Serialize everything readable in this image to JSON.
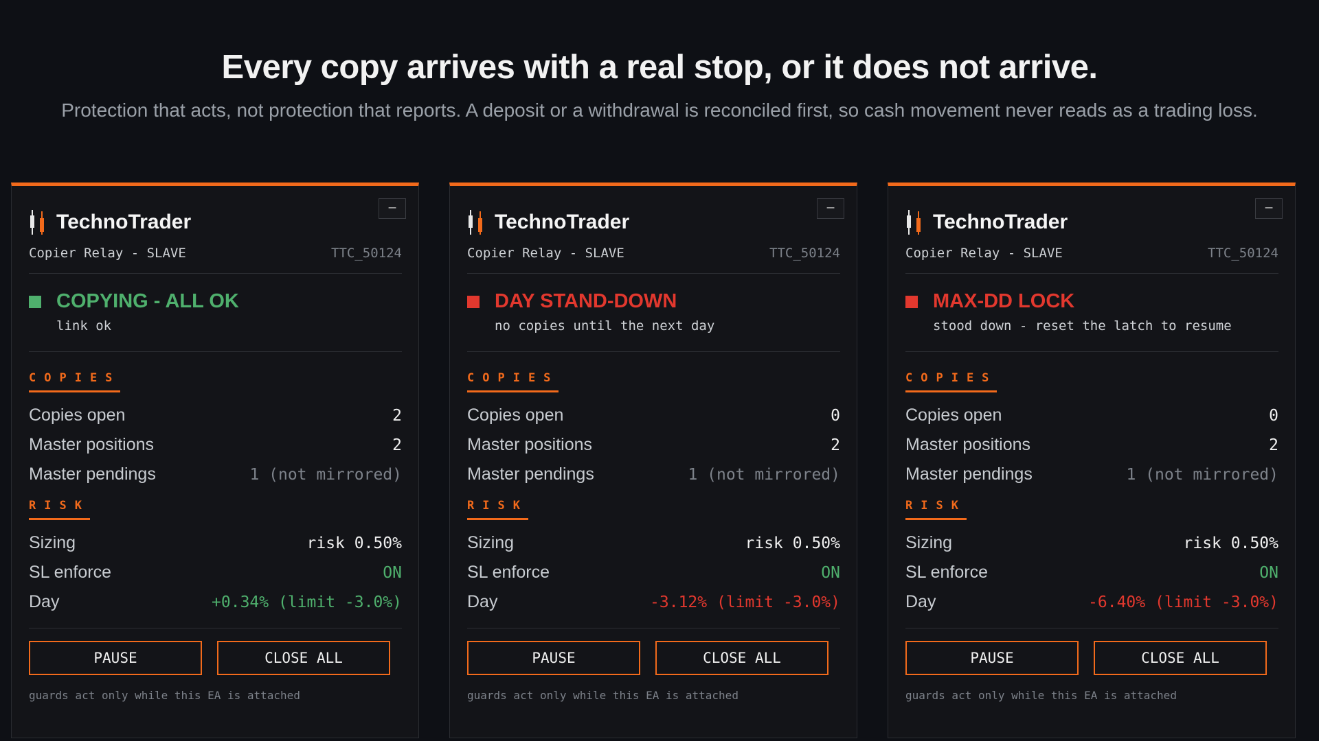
{
  "hero": {
    "title": "Every copy arrives with a real stop, or it does not arrive.",
    "subtitle": "Protection that acts, not protection that reports. A deposit or a withdrawal is reconciled first, so cash movement never reads as a trading loss."
  },
  "colors": {
    "accent": "#f26a1b",
    "ok": "#4fb06d",
    "alert": "#e2382e"
  },
  "cards": [
    {
      "brand": "TechnoTrader",
      "minimize_label": "–",
      "role": "Copier Relay - SLAVE",
      "account": "TTC_50124",
      "status": {
        "title": "COPYING - ALL OK",
        "detail": "link ok",
        "color": "#4fb06d"
      },
      "copies": {
        "label": "COPIES",
        "copies_open_label": "Copies open",
        "copies_open": "2",
        "master_positions_label": "Master positions",
        "master_positions": "2",
        "master_pendings_label": "Master pendings",
        "master_pendings": "1 (not mirrored)"
      },
      "risk": {
        "label": "RISK",
        "sizing_label": "Sizing",
        "sizing": "risk 0.50%",
        "sl_label": "SL enforce",
        "sl": "ON",
        "day_label": "Day",
        "day": "+0.34% (limit -3.0%)",
        "day_state": "pos"
      },
      "pause_label": "PAUSE",
      "close_all_label": "CLOSE ALL",
      "footnote": "guards act only while this EA is attached"
    },
    {
      "brand": "TechnoTrader",
      "minimize_label": "–",
      "role": "Copier Relay - SLAVE",
      "account": "TTC_50124",
      "status": {
        "title": "DAY STAND-DOWN",
        "detail": "no copies until the next day",
        "color": "#e2382e"
      },
      "copies": {
        "label": "COPIES",
        "copies_open_label": "Copies open",
        "copies_open": "0",
        "master_positions_label": "Master positions",
        "master_positions": "2",
        "master_pendings_label": "Master pendings",
        "master_pendings": "1 (not mirrored)"
      },
      "risk": {
        "label": "RISK",
        "sizing_label": "Sizing",
        "sizing": "risk 0.50%",
        "sl_label": "SL enforce",
        "sl": "ON",
        "day_label": "Day",
        "day": "-3.12% (limit -3.0%)",
        "day_state": "neg"
      },
      "pause_label": "PAUSE",
      "close_all_label": "CLOSE ALL",
      "footnote": "guards act only while this EA is attached"
    },
    {
      "brand": "TechnoTrader",
      "minimize_label": "–",
      "role": "Copier Relay - SLAVE",
      "account": "TTC_50124",
      "status": {
        "title": "MAX-DD LOCK",
        "detail": "stood down - reset the latch to resume",
        "color": "#e2382e"
      },
      "copies": {
        "label": "COPIES",
        "copies_open_label": "Copies open",
        "copies_open": "0",
        "master_positions_label": "Master positions",
        "master_positions": "2",
        "master_pendings_label": "Master pendings",
        "master_pendings": "1 (not mirrored)"
      },
      "risk": {
        "label": "RISK",
        "sizing_label": "Sizing",
        "sizing": "risk 0.50%",
        "sl_label": "SL enforce",
        "sl": "ON",
        "day_label": "Day",
        "day": "-6.40% (limit -3.0%)",
        "day_state": "neg"
      },
      "pause_label": "PAUSE",
      "close_all_label": "CLOSE ALL",
      "footnote": "guards act only while this EA is attached"
    }
  ]
}
